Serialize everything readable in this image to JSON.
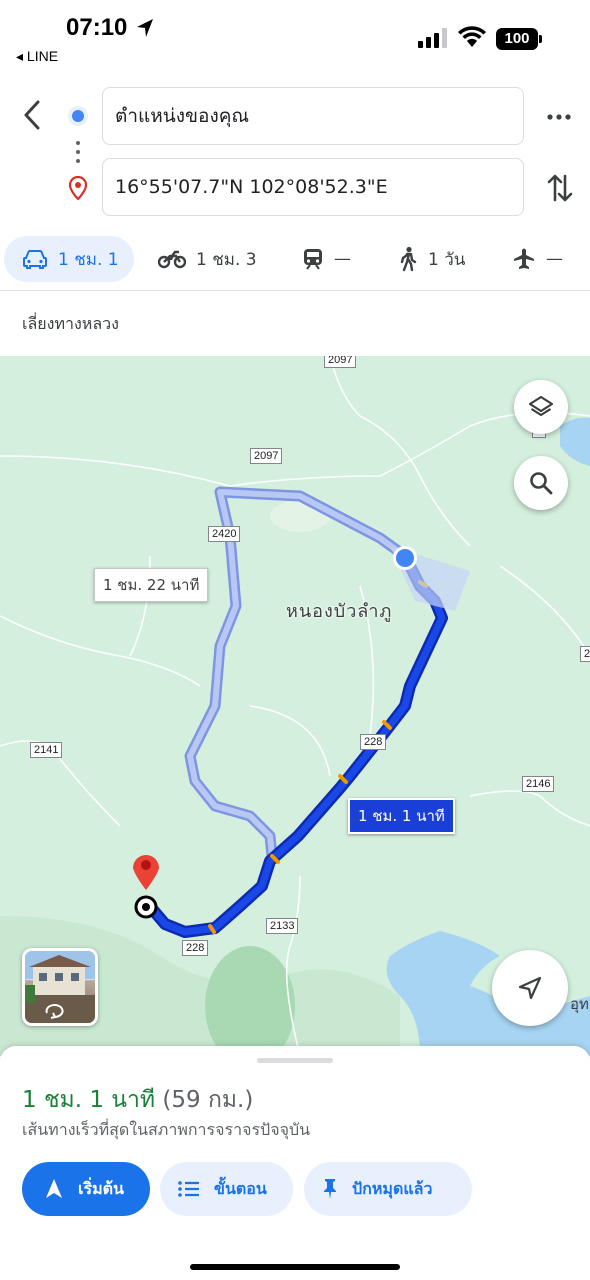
{
  "status_bar": {
    "time": "07:10",
    "back_app": "◂ LINE",
    "battery": "100"
  },
  "directions": {
    "origin": "ตำแหน่งของคุณ",
    "destination": "16°55'07.7\"N 102°08'52.3\"E"
  },
  "modes": [
    {
      "name": "drive",
      "label": "1 ชม. 1",
      "active": true
    },
    {
      "name": "motorcycle",
      "label": "1 ชม. 3"
    },
    {
      "name": "transit",
      "label": "—"
    },
    {
      "name": "walk",
      "label": "1 วัน"
    },
    {
      "name": "flight",
      "label": "—"
    }
  ],
  "options": {
    "avoid": "เลี่ยงทางหลวง"
  },
  "map": {
    "place_label": "หนองบัวลำภู",
    "alt_route_time": "1 ชม. 22 นาที",
    "main_route_time": "1 ชม. 1 นาที",
    "edge_label": "อุท",
    "road_shields": [
      "2097",
      "2097",
      "2420",
      "228",
      "2141",
      "2146",
      "2133",
      "228",
      "2",
      "2"
    ],
    "colors": {
      "route": "#1a47e8",
      "alt_route": "#a9b9f0",
      "land": "#d4efdd",
      "water": "#a7d4f2"
    }
  },
  "summary": {
    "duration": "1 ชม. 1 นาที",
    "distance": "(59 กม.)",
    "subtitle": "เส้นทางเร็วที่สุดในสภาพการจราจรปัจจุบัน"
  },
  "actions": {
    "start": "เริ่มต้น",
    "steps": "ขั้นตอน",
    "pinned": "ปักหมุดแล้ว"
  }
}
